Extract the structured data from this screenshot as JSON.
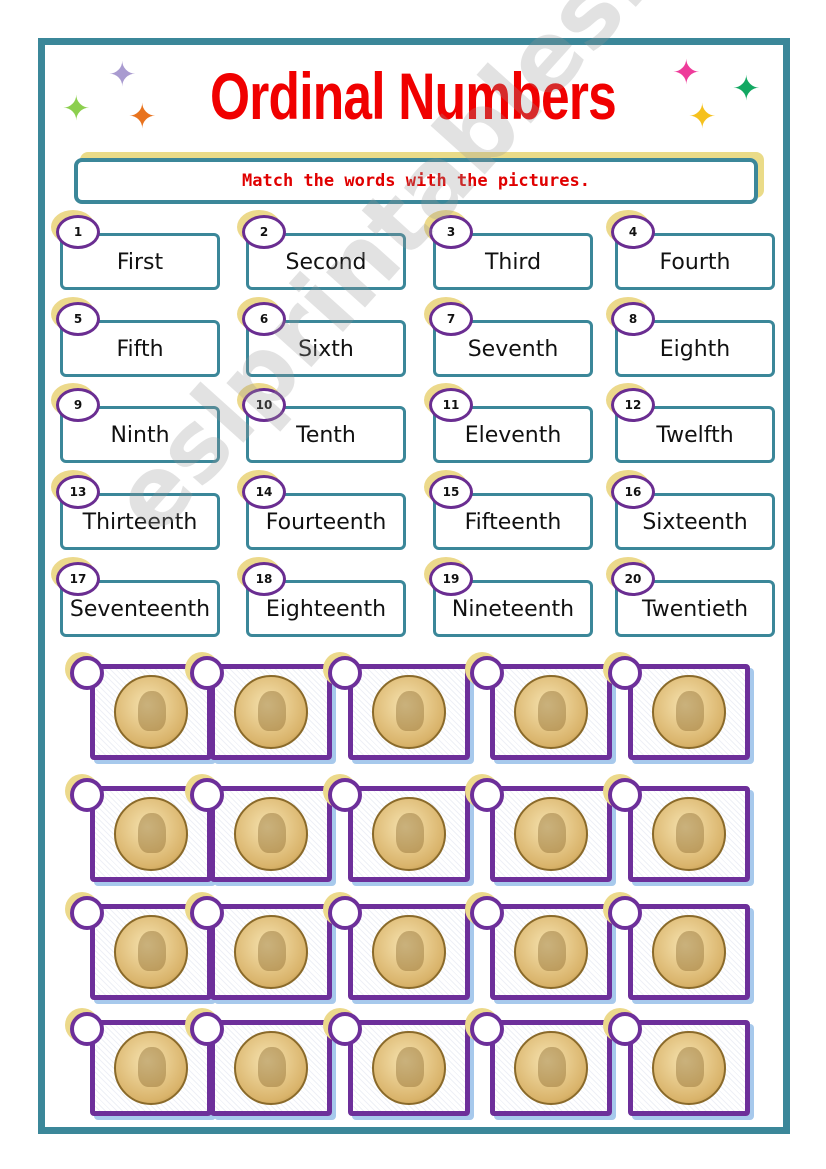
{
  "title": "Ordinal Numbers",
  "instruction": "Match the words with the pictures.",
  "colors": {
    "border": "#3b8799",
    "title": "#f00000",
    "circle": "#6a2d91"
  },
  "stars": [
    {
      "color": "#a99bd0"
    },
    {
      "color": "#8ccf4e"
    },
    {
      "color": "#e8731e"
    },
    {
      "color": "#ee3b9a"
    },
    {
      "color": "#13a862"
    },
    {
      "color": "#f5c11e"
    }
  ],
  "words": [
    {
      "n": "1",
      "w": "First"
    },
    {
      "n": "2",
      "w": "Second"
    },
    {
      "n": "3",
      "w": "Third"
    },
    {
      "n": "4",
      "w": "Fourth"
    },
    {
      "n": "5",
      "w": "Fifth"
    },
    {
      "n": "6",
      "w": "Sixth"
    },
    {
      "n": "7",
      "w": "Seventh"
    },
    {
      "n": "8",
      "w": "Eighth"
    },
    {
      "n": "9",
      "w": "Ninth"
    },
    {
      "n": "10",
      "w": "Tenth"
    },
    {
      "n": "11",
      "w": "Eleventh"
    },
    {
      "n": "12",
      "w": "Twelfth"
    },
    {
      "n": "13",
      "w": "Thirteenth"
    },
    {
      "n": "14",
      "w": "Fourteenth"
    },
    {
      "n": "15",
      "w": "Fifteenth"
    },
    {
      "n": "16",
      "w": "Sixteenth"
    },
    {
      "n": "17",
      "w": "Seventeenth"
    },
    {
      "n": "18",
      "w": "Eighteenth"
    },
    {
      "n": "19",
      "w": "Nineteenth"
    },
    {
      "n": "20",
      "w": "Twentieth"
    }
  ],
  "coin_count": 20,
  "watermark": "eslprintables.com"
}
